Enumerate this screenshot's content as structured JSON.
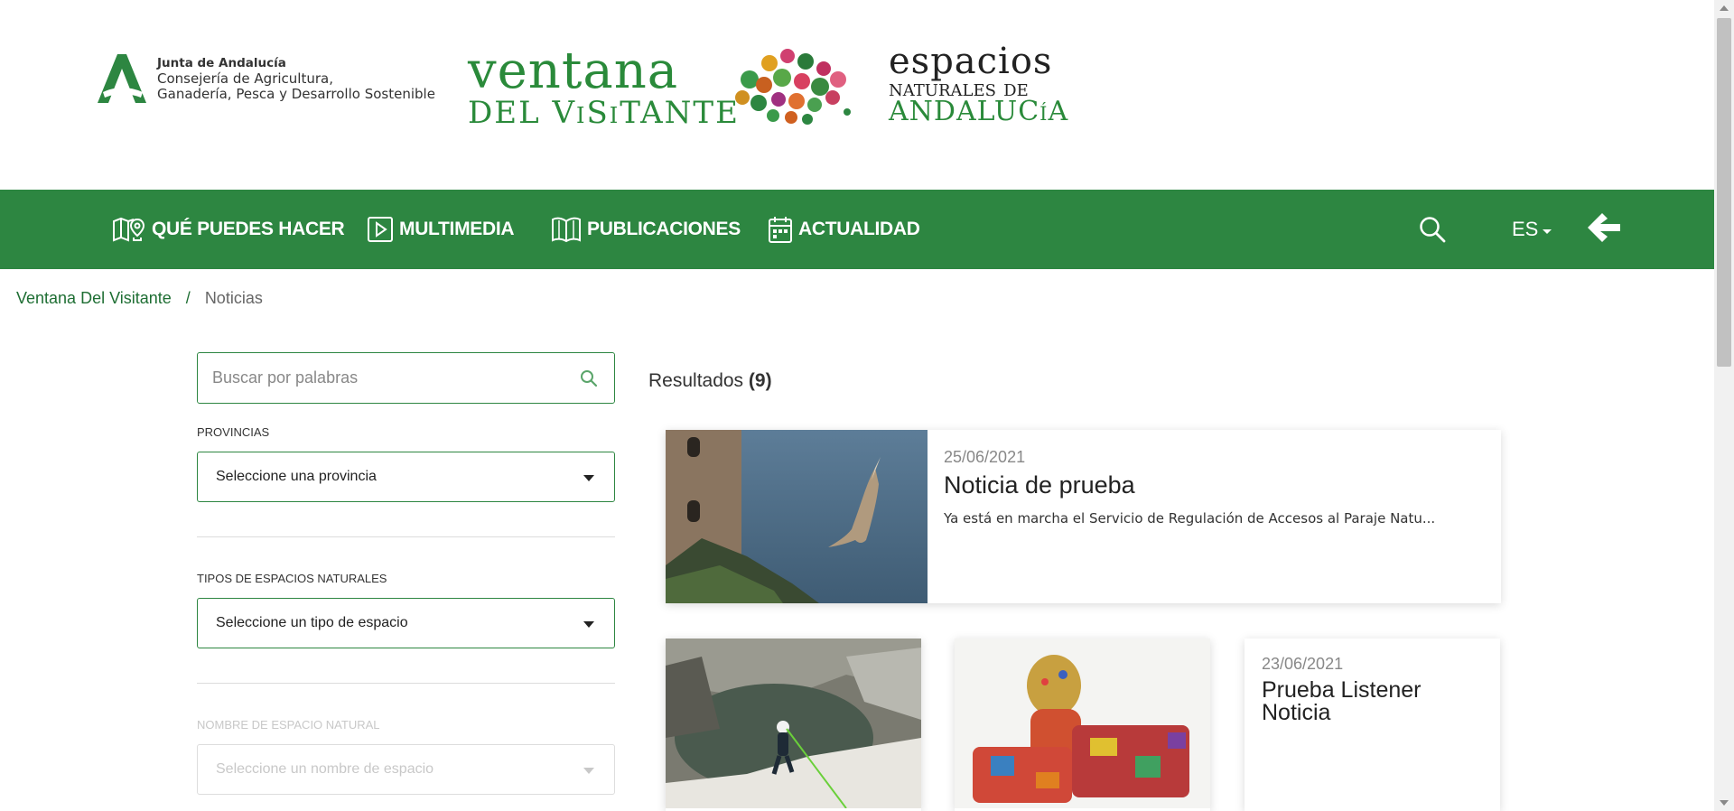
{
  "header": {
    "junta": {
      "line1": "Junta de Andalucía",
      "line2": "Consejería de Agricultura,",
      "line3": "Ganadería, Pesca y Desarrollo Sostenible"
    },
    "ventana": {
      "line1": "ventana",
      "line2": "DEL ViSiTANTE"
    },
    "espacios": {
      "line1": "espacios",
      "line2": "naturales de",
      "line3": "ANDALUCíA"
    }
  },
  "nav": {
    "items": [
      {
        "label": "QUÉ PUEDES HACER",
        "icon": "map-pin-icon"
      },
      {
        "label": "MULTIMEDIA",
        "icon": "play-icon"
      },
      {
        "label": "PUBLICACIONES",
        "icon": "book-icon"
      },
      {
        "label": "ACTUALIDAD",
        "icon": "calendar-icon"
      }
    ],
    "language": "ES",
    "search_icon": "search-icon",
    "back_icon": "arrow-left-icon"
  },
  "breadcrumb": {
    "home": "Ventana Del Visitante",
    "separator": "/",
    "current": "Noticias"
  },
  "filters": {
    "search_placeholder": "Buscar por palabras",
    "provincias_label": "PROVINCIAS",
    "provincias_value": "Seleccione una provincia",
    "tipos_label": "TIPOS DE ESPACIOS NATURALES",
    "tipos_value": "Seleccione un tipo de espacio",
    "nombre_label": "NOMBRE DE ESPACIO NATURAL",
    "nombre_value": "Seleccione un nombre de espacio"
  },
  "results": {
    "label": "Resultados",
    "count": "(9)",
    "featured": {
      "date": "25/06/2021",
      "title": "Noticia de prueba",
      "description": "Ya está en marcha el Servicio de Regulación de Accesos al Paraje Natu..."
    },
    "cards": [
      {
        "type": "image"
      },
      {
        "type": "image"
      },
      {
        "date": "23/06/2021",
        "title": "Prueba Listener Noticia"
      }
    ]
  },
  "colors": {
    "brand_green": "#2d8641",
    "link_green": "#1e6e33"
  }
}
